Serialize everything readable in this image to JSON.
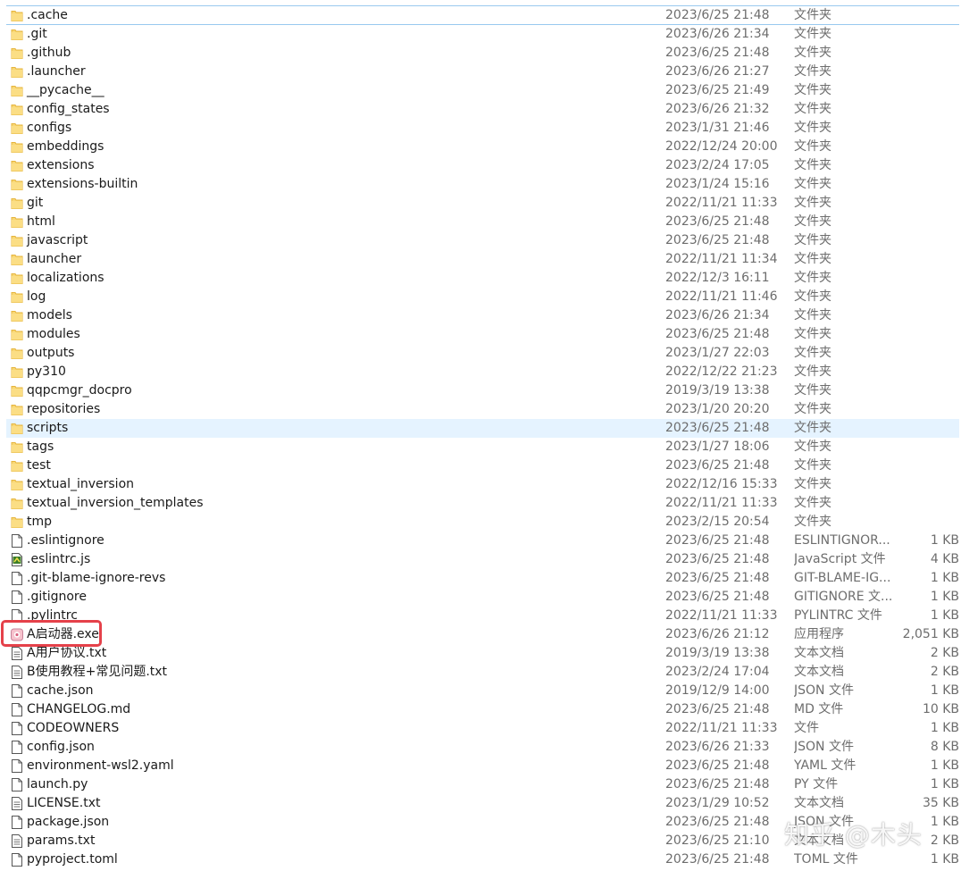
{
  "files": [
    {
      "name": ".cache",
      "date": "2023/6/25 21:48",
      "type": "文件夹",
      "size": "",
      "icon": "folder-icon"
    },
    {
      "name": ".git",
      "date": "2023/6/26 21:34",
      "type": "文件夹",
      "size": "",
      "icon": "folder-icon"
    },
    {
      "name": ".github",
      "date": "2023/6/25 21:48",
      "type": "文件夹",
      "size": "",
      "icon": "folder-icon"
    },
    {
      "name": ".launcher",
      "date": "2023/6/26 21:27",
      "type": "文件夹",
      "size": "",
      "icon": "folder-icon"
    },
    {
      "name": "__pycache__",
      "date": "2023/6/25 21:49",
      "type": "文件夹",
      "size": "",
      "icon": "folder-icon"
    },
    {
      "name": "config_states",
      "date": "2023/6/26 21:32",
      "type": "文件夹",
      "size": "",
      "icon": "folder-icon"
    },
    {
      "name": "configs",
      "date": "2023/1/31 21:46",
      "type": "文件夹",
      "size": "",
      "icon": "folder-icon"
    },
    {
      "name": "embeddings",
      "date": "2022/12/24 20:00",
      "type": "文件夹",
      "size": "",
      "icon": "folder-icon"
    },
    {
      "name": "extensions",
      "date": "2023/2/24 17:05",
      "type": "文件夹",
      "size": "",
      "icon": "folder-icon"
    },
    {
      "name": "extensions-builtin",
      "date": "2023/1/24 15:16",
      "type": "文件夹",
      "size": "",
      "icon": "folder-icon"
    },
    {
      "name": "git",
      "date": "2022/11/21 11:33",
      "type": "文件夹",
      "size": "",
      "icon": "folder-icon"
    },
    {
      "name": "html",
      "date": "2023/6/25 21:48",
      "type": "文件夹",
      "size": "",
      "icon": "folder-icon"
    },
    {
      "name": "javascript",
      "date": "2023/6/25 21:48",
      "type": "文件夹",
      "size": "",
      "icon": "folder-icon"
    },
    {
      "name": "launcher",
      "date": "2022/11/21 11:34",
      "type": "文件夹",
      "size": "",
      "icon": "folder-icon"
    },
    {
      "name": "localizations",
      "date": "2022/12/3 16:11",
      "type": "文件夹",
      "size": "",
      "icon": "folder-icon"
    },
    {
      "name": "log",
      "date": "2022/11/21 11:46",
      "type": "文件夹",
      "size": "",
      "icon": "folder-icon"
    },
    {
      "name": "models",
      "date": "2023/6/26 21:34",
      "type": "文件夹",
      "size": "",
      "icon": "folder-icon"
    },
    {
      "name": "modules",
      "date": "2023/6/25 21:48",
      "type": "文件夹",
      "size": "",
      "icon": "folder-icon"
    },
    {
      "name": "outputs",
      "date": "2023/1/27 22:03",
      "type": "文件夹",
      "size": "",
      "icon": "folder-icon"
    },
    {
      "name": "py310",
      "date": "2022/12/22 21:23",
      "type": "文件夹",
      "size": "",
      "icon": "folder-icon"
    },
    {
      "name": "qqpcmgr_docpro",
      "date": "2019/3/19 13:38",
      "type": "文件夹",
      "size": "",
      "icon": "folder-icon"
    },
    {
      "name": "repositories",
      "date": "2023/1/20 20:20",
      "type": "文件夹",
      "size": "",
      "icon": "folder-icon"
    },
    {
      "name": "scripts",
      "date": "2023/6/25 21:48",
      "type": "文件夹",
      "size": "",
      "icon": "folder-icon"
    },
    {
      "name": "tags",
      "date": "2023/1/27 18:06",
      "type": "文件夹",
      "size": "",
      "icon": "folder-icon"
    },
    {
      "name": "test",
      "date": "2023/6/25 21:48",
      "type": "文件夹",
      "size": "",
      "icon": "folder-icon"
    },
    {
      "name": "textual_inversion",
      "date": "2022/12/16 15:33",
      "type": "文件夹",
      "size": "",
      "icon": "folder-icon"
    },
    {
      "name": "textual_inversion_templates",
      "date": "2022/11/21 11:33",
      "type": "文件夹",
      "size": "",
      "icon": "folder-icon"
    },
    {
      "name": "tmp",
      "date": "2023/2/15 20:54",
      "type": "文件夹",
      "size": "",
      "icon": "folder-icon"
    },
    {
      "name": ".eslintignore",
      "date": "2023/6/25 21:48",
      "type": "ESLINTIGNOR...",
      "size": "1 KB",
      "icon": "file-icon"
    },
    {
      "name": ".eslintrc.js",
      "date": "2023/6/25 21:48",
      "type": "JavaScript 文件",
      "size": "4 KB",
      "icon": "js-file-icon"
    },
    {
      "name": ".git-blame-ignore-revs",
      "date": "2023/6/25 21:48",
      "type": "GIT-BLAME-IG...",
      "size": "1 KB",
      "icon": "file-icon"
    },
    {
      "name": ".gitignore",
      "date": "2023/6/25 21:48",
      "type": "GITIGNORE 文...",
      "size": "1 KB",
      "icon": "file-icon"
    },
    {
      "name": ".pylintrc",
      "date": "2022/11/21 11:33",
      "type": "PYLINTRC 文件",
      "size": "1 KB",
      "icon": "file-icon"
    },
    {
      "name": "A启动器.exe",
      "date": "2023/6/26 21:12",
      "type": "应用程序",
      "size": "2,051 KB",
      "icon": "app-icon"
    },
    {
      "name": "A用户协议.txt",
      "date": "2019/3/19 13:38",
      "type": "文本文档",
      "size": "2 KB",
      "icon": "text-file-icon"
    },
    {
      "name": "B使用教程+常见问题.txt",
      "date": "2023/2/24 17:04",
      "type": "文本文档",
      "size": "2 KB",
      "icon": "text-file-icon"
    },
    {
      "name": "cache.json",
      "date": "2019/12/9 14:00",
      "type": "JSON 文件",
      "size": "1 KB",
      "icon": "file-icon"
    },
    {
      "name": "CHANGELOG.md",
      "date": "2023/6/25 21:48",
      "type": "MD 文件",
      "size": "10 KB",
      "icon": "file-icon"
    },
    {
      "name": "CODEOWNERS",
      "date": "2022/11/21 11:33",
      "type": "文件",
      "size": "1 KB",
      "icon": "file-icon"
    },
    {
      "name": "config.json",
      "date": "2023/6/26 21:33",
      "type": "JSON 文件",
      "size": "8 KB",
      "icon": "file-icon"
    },
    {
      "name": "environment-wsl2.yaml",
      "date": "2023/6/25 21:48",
      "type": "YAML 文件",
      "size": "1 KB",
      "icon": "file-icon"
    },
    {
      "name": "launch.py",
      "date": "2023/6/25 21:48",
      "type": "PY 文件",
      "size": "1 KB",
      "icon": "file-icon"
    },
    {
      "name": "LICENSE.txt",
      "date": "2023/1/29 10:52",
      "type": "文本文档",
      "size": "35 KB",
      "icon": "text-file-icon"
    },
    {
      "name": "package.json",
      "date": "2023/6/25 21:48",
      "type": "JSON 文件",
      "size": "1 KB",
      "icon": "file-icon"
    },
    {
      "name": "params.txt",
      "date": "2023/6/25 21:10",
      "type": "文本文档",
      "size": "2 KB",
      "icon": "text-file-icon"
    },
    {
      "name": "pyproject.toml",
      "date": "2023/6/25 21:48",
      "type": "TOML 文件",
      "size": "1 KB",
      "icon": "file-icon"
    }
  ],
  "selected_index": 0,
  "hover_index": 22,
  "highlighted_index": 33,
  "watermark": "知乎 @木头",
  "colors": {
    "folder": "#f8d775",
    "folder_dark": "#e6b43c",
    "selection_border": "#99c9ef",
    "hover_bg": "#e5f3ff",
    "highlight_box": "#e5414a",
    "secondary_text": "#6d6d6d"
  }
}
